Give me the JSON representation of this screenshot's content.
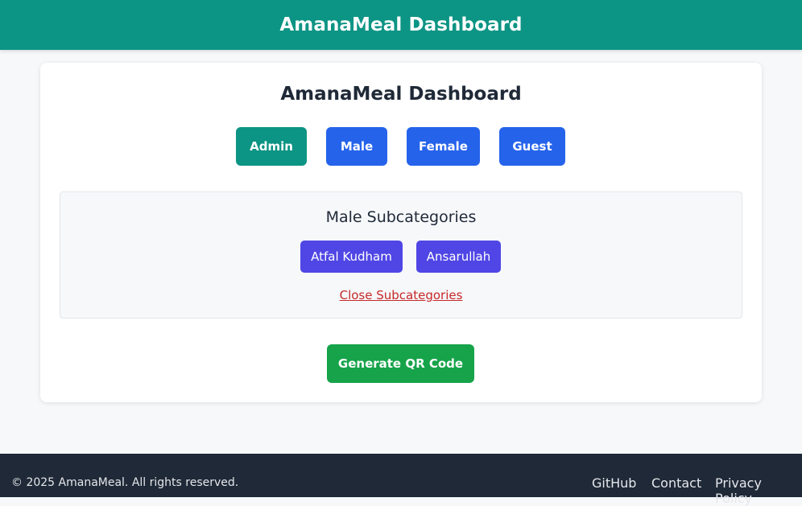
{
  "header": {
    "title": "AmanaMeal Dashboard"
  },
  "card": {
    "title": "AmanaMeal Dashboard",
    "roles": [
      {
        "label": "Admin"
      },
      {
        "label": "Male"
      },
      {
        "label": "Female"
      },
      {
        "label": "Guest"
      }
    ],
    "subcategories": {
      "title": "Male Subcategories",
      "items": [
        {
          "label": "Atfal Kudham"
        },
        {
          "label": "Ansarullah"
        }
      ],
      "close_label": "Close Subcategories"
    },
    "generate_label": "Generate QR Code"
  },
  "footer": {
    "copyright": "© 2025 AmanaMeal. All rights reserved.",
    "links": [
      {
        "label": "GitHub"
      },
      {
        "label": "Contact"
      },
      {
        "label": "Privacy Policy"
      }
    ]
  },
  "colors": {
    "header_bg": "#0c9484",
    "admin": "#0c9484",
    "role": "#2563eb",
    "subcategory": "#4f46e5",
    "close_link": "#c62828",
    "generate": "#16a34a",
    "footer_bg": "#1f2937"
  }
}
